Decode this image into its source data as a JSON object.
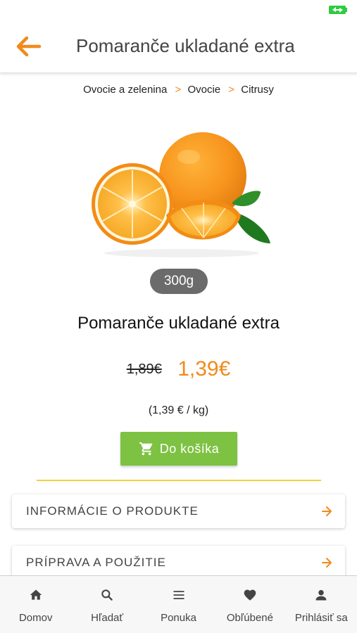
{
  "header": {
    "title": "Pomaranče ukladané extra"
  },
  "breadcrumb": {
    "items": [
      "Ovocie a zelenina",
      "Ovocie",
      "Citrusy"
    ],
    "separator": ">"
  },
  "product": {
    "weight": "300g",
    "name": "Pomaranče ukladané extra",
    "old_price": "1,89€",
    "price": "1,39€",
    "unit_price": "(1,39 € / kg)",
    "add_to_cart_label": "Do košíka"
  },
  "sections": [
    {
      "label": "INFORMÁCIE O PRODUKTE"
    },
    {
      "label": "PRÍPRAVA A POUŽITIE"
    }
  ],
  "bottom_nav": {
    "items": [
      {
        "label": "Domov",
        "icon": "home-icon"
      },
      {
        "label": "Hľadať",
        "icon": "search-icon"
      },
      {
        "label": "Ponuka",
        "icon": "menu-icon"
      },
      {
        "label": "Obľúbené",
        "icon": "heart-icon"
      },
      {
        "label": "Prihlásiť sa",
        "icon": "person-icon"
      }
    ]
  },
  "colors": {
    "accent": "#f08a1c",
    "cart_button": "#7dc242",
    "divider": "#f4d03f",
    "badge": "#6b6b6b"
  }
}
